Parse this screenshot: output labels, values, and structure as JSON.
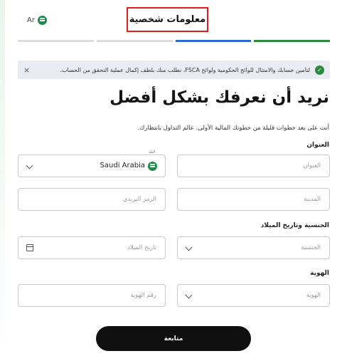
{
  "header": {
    "language_label": "Ar",
    "title": "معلومات شخصية"
  },
  "progress": {
    "steps": [
      {
        "state": "inactive"
      },
      {
        "state": "inactive"
      },
      {
        "state": "active-blue"
      },
      {
        "state": "complete-green"
      }
    ],
    "colors": {
      "inactive": "#dcdcdc",
      "blue": "#2a6bd8",
      "green": "#2a8a3e"
    }
  },
  "alert": {
    "icon": "shield-check-icon",
    "text": "لتأمين حسابك والامتثال للوائح الحكومية ولوائح FSCA، نطلب منك بلطف إكمال عملية التحقق من الحساب.",
    "close_label": "×"
  },
  "main": {
    "heading": "نريد أن نعرفك بشكل أفضل",
    "intro": "أنت على بعد خطوات قليلة من خطوتك المالية الأولى. عالم التداول بانتظارك."
  },
  "sections": {
    "address": "العنوان",
    "nationality_dob": "الجنسية وتاريخ الميلاد",
    "identity": "الهوية"
  },
  "fields": {
    "address_placeholder": "العنوان",
    "country_label": "البلد",
    "country_value": "Saudi Arabia",
    "city_placeholder": "المدينة",
    "postal_placeholder": "الرمز البريدي",
    "nationality_placeholder": "الجنسية",
    "dob_placeholder": "تاريخ الميلاد",
    "id_type_placeholder": "الهوية",
    "id_number_placeholder": "رقم الهوية"
  },
  "buttons": {
    "submit": "متابعة"
  },
  "colors": {
    "brand_green": "#2a8a3e",
    "highlight_red": "#e21d1d",
    "button_black": "#0f0f0f"
  }
}
